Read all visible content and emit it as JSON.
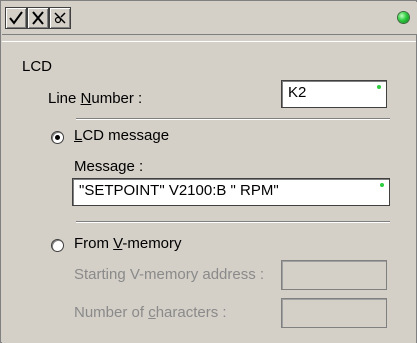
{
  "toolbar": {
    "accept_icon": "check-icon",
    "cancel_icon": "x-icon",
    "help_icon": "help-icon",
    "status_color": "#2ecc40"
  },
  "section_title": "LCD",
  "line_number": {
    "label_pre": "Line ",
    "label_u": "N",
    "label_post": "umber :",
    "value": "K2"
  },
  "lcd_message": {
    "selected": true,
    "label_u": "L",
    "label_post": "CD message",
    "message_label": "Message :",
    "message_value": "\"SETPOINT\" V2100:B \" RPM\""
  },
  "from_vmemory": {
    "selected": false,
    "label_pre": "From ",
    "label_u": "V",
    "label_post": "-memory",
    "start_label": "Starting V-memory address :",
    "count_label_pre": "Number of ",
    "count_label_u": "c",
    "count_label_post": "haracters :",
    "start_value": "",
    "count_value": ""
  }
}
